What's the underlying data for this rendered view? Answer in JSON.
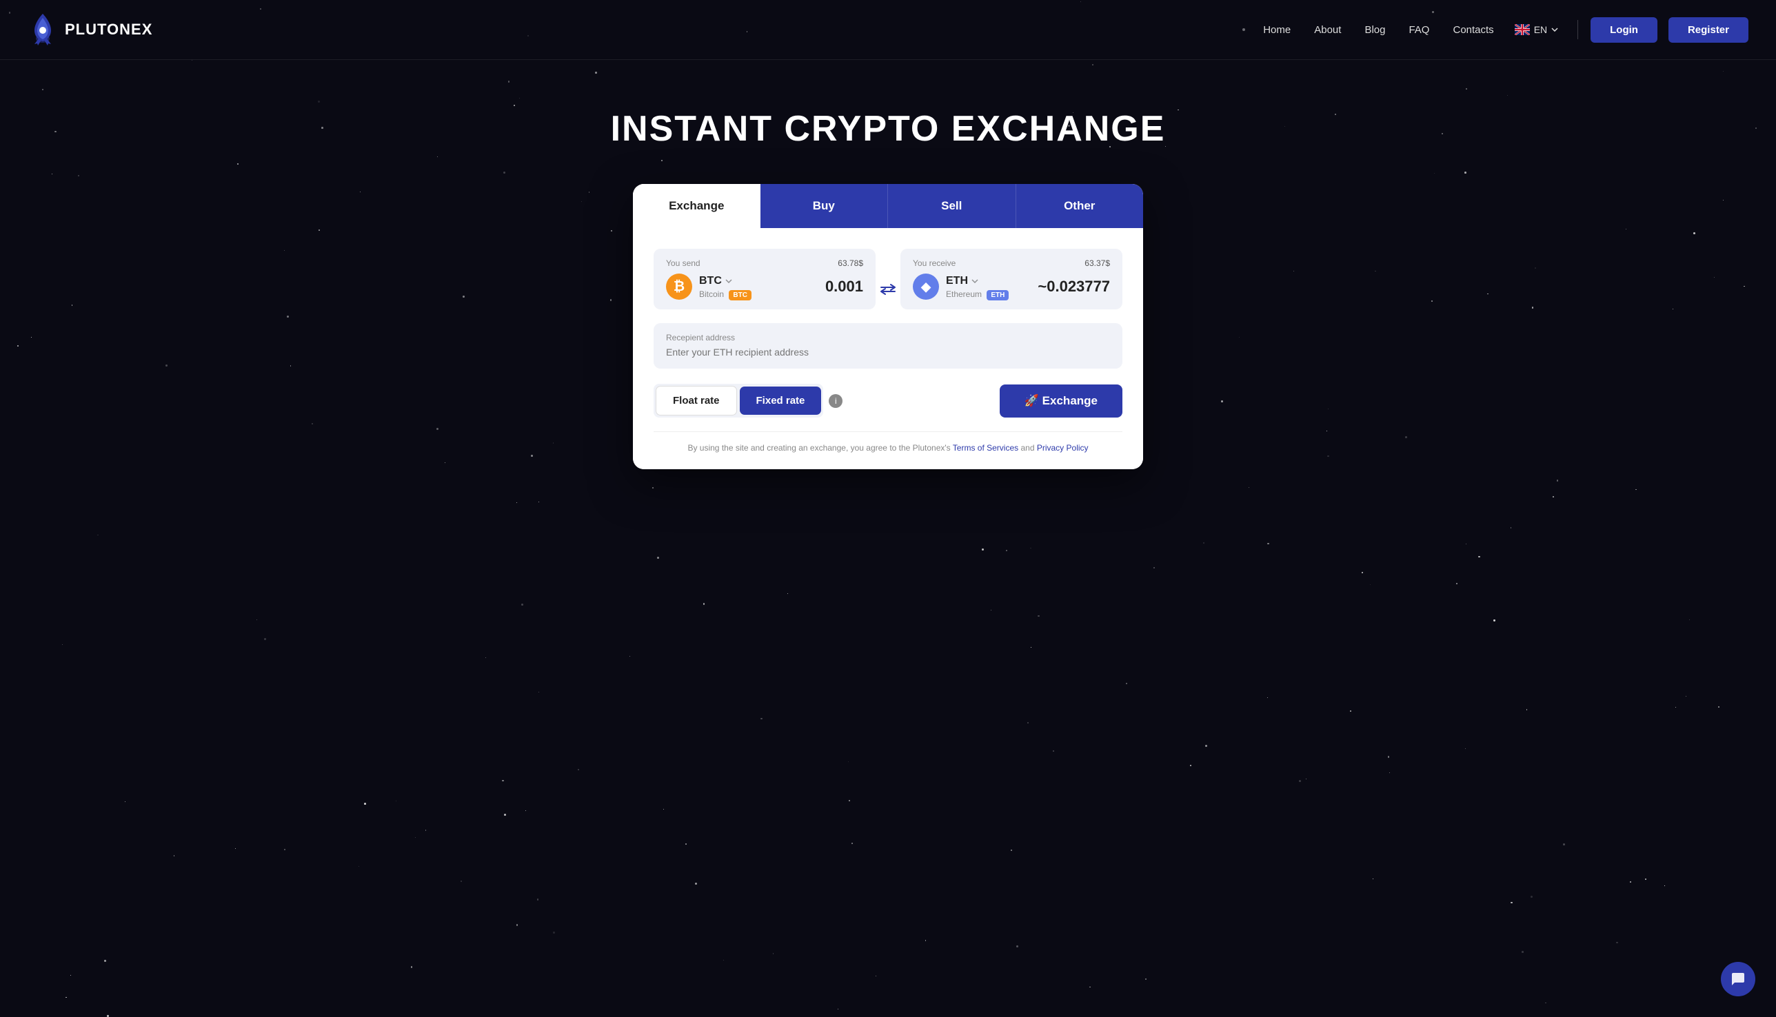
{
  "brand": {
    "name": "PLUTONEX"
  },
  "nav": {
    "links": [
      "Home",
      "About",
      "Blog",
      "FAQ",
      "Contacts"
    ],
    "lang": "EN",
    "login_label": "Login",
    "register_label": "Register"
  },
  "hero": {
    "title": "INSTANT CRYPTO EXCHANGE"
  },
  "exchange_card": {
    "tabs": [
      "Exchange",
      "Buy",
      "Sell",
      "Other"
    ],
    "active_tab": "Exchange",
    "you_send_label": "You send",
    "you_send_value": "63.78$",
    "you_receive_label": "You receive",
    "you_receive_value": "63.37$",
    "send_coin": {
      "ticker": "BTC",
      "name": "Bitcoin",
      "tag": "BTC",
      "amount": "0.001"
    },
    "receive_coin": {
      "ticker": "ETH",
      "name": "Ethereum",
      "tag": "ETH",
      "amount": "~0.023777"
    },
    "recipient_label": "Recepient address",
    "recipient_placeholder": "Enter your ETH recipient address",
    "float_rate_label": "Float rate",
    "fixed_rate_label": "Fixed rate",
    "exchange_button_label": "🚀 Exchange",
    "footer_text_before": "By using the site and creating an exchange, you agree to the Plutonex's ",
    "footer_terms": "Terms of Services",
    "footer_and": " and ",
    "footer_privacy": "Privacy Policy"
  }
}
